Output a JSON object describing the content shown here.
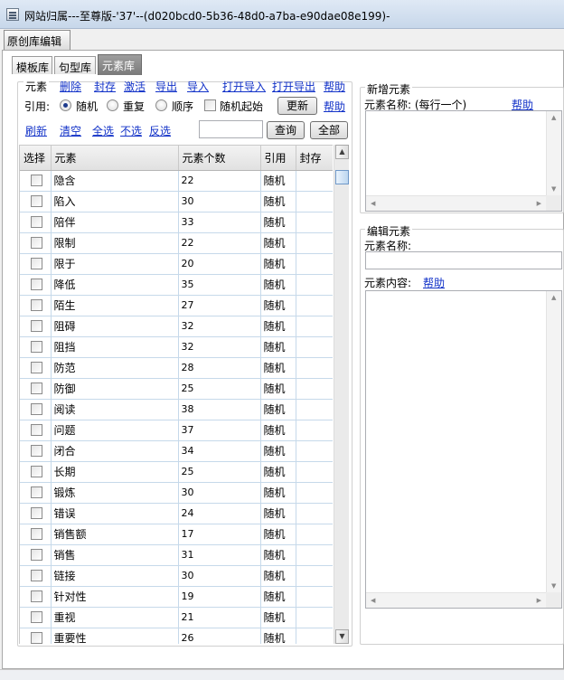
{
  "window": {
    "title": "网站归属---至尊版-'37'--(d020bcd0-5b36-48d0-a7ba-e90dae08e199)-"
  },
  "outer_tab": {
    "label": "原创库编辑"
  },
  "inner_tabs": [
    {
      "label": "模板库",
      "active": false
    },
    {
      "label": "句型库",
      "active": false
    },
    {
      "label": "元素库",
      "active": true
    }
  ],
  "elements_panel": {
    "group_title": "元素",
    "actions": [
      "删除",
      "封存",
      "激活",
      "导出",
      "导入",
      "打开导入",
      "打开导出",
      "帮助"
    ],
    "ref_label": "引用:",
    "ref_options": [
      {
        "label": "随机",
        "checked": true
      },
      {
        "label": "重复",
        "checked": false
      },
      {
        "label": "顺序",
        "checked": false
      }
    ],
    "random_start": {
      "label": "随机起始",
      "checked": false
    },
    "update_button": "更新",
    "help2": "帮助",
    "links2": [
      "刷新",
      "清空",
      "全选",
      "不选",
      "反选"
    ],
    "search_value": "",
    "query_button": "查询",
    "all_button": "全部",
    "table": {
      "headers": [
        "选择",
        "元素",
        "元素个数",
        "引用",
        "封存"
      ],
      "rows": [
        {
          "name": "隐含",
          "count": "22",
          "ref": "随机",
          "sealed": ""
        },
        {
          "name": "陷入",
          "count": "30",
          "ref": "随机",
          "sealed": ""
        },
        {
          "name": "陪伴",
          "count": "33",
          "ref": "随机",
          "sealed": ""
        },
        {
          "name": "限制",
          "count": "22",
          "ref": "随机",
          "sealed": ""
        },
        {
          "name": "限于",
          "count": "20",
          "ref": "随机",
          "sealed": ""
        },
        {
          "name": "降低",
          "count": "35",
          "ref": "随机",
          "sealed": ""
        },
        {
          "name": "陌生",
          "count": "27",
          "ref": "随机",
          "sealed": ""
        },
        {
          "name": "阻碍",
          "count": "32",
          "ref": "随机",
          "sealed": ""
        },
        {
          "name": "阻挡",
          "count": "32",
          "ref": "随机",
          "sealed": ""
        },
        {
          "name": "防范",
          "count": "28",
          "ref": "随机",
          "sealed": ""
        },
        {
          "name": "防御",
          "count": "25",
          "ref": "随机",
          "sealed": ""
        },
        {
          "name": "阅读",
          "count": "38",
          "ref": "随机",
          "sealed": ""
        },
        {
          "name": "问题",
          "count": "37",
          "ref": "随机",
          "sealed": ""
        },
        {
          "name": "闭合",
          "count": "34",
          "ref": "随机",
          "sealed": ""
        },
        {
          "name": "长期",
          "count": "25",
          "ref": "随机",
          "sealed": ""
        },
        {
          "name": "锻炼",
          "count": "30",
          "ref": "随机",
          "sealed": ""
        },
        {
          "name": "错误",
          "count": "24",
          "ref": "随机",
          "sealed": ""
        },
        {
          "name": "销售额",
          "count": "17",
          "ref": "随机",
          "sealed": ""
        },
        {
          "name": "销售",
          "count": "31",
          "ref": "随机",
          "sealed": ""
        },
        {
          "name": "链接",
          "count": "30",
          "ref": "随机",
          "sealed": ""
        },
        {
          "name": "针对性",
          "count": "19",
          "ref": "随机",
          "sealed": ""
        },
        {
          "name": "重视",
          "count": "21",
          "ref": "随机",
          "sealed": ""
        },
        {
          "name": "重要性",
          "count": "26",
          "ref": "随机",
          "sealed": ""
        }
      ]
    }
  },
  "new_element": {
    "group_title": "新增元素",
    "name_label": "元素名称: (每行一个)",
    "help": "帮助"
  },
  "edit_element": {
    "group_title": "编辑元素",
    "name_label": "元素名称:",
    "name_value": "",
    "content_label": "元素内容:",
    "help": "帮助"
  }
}
